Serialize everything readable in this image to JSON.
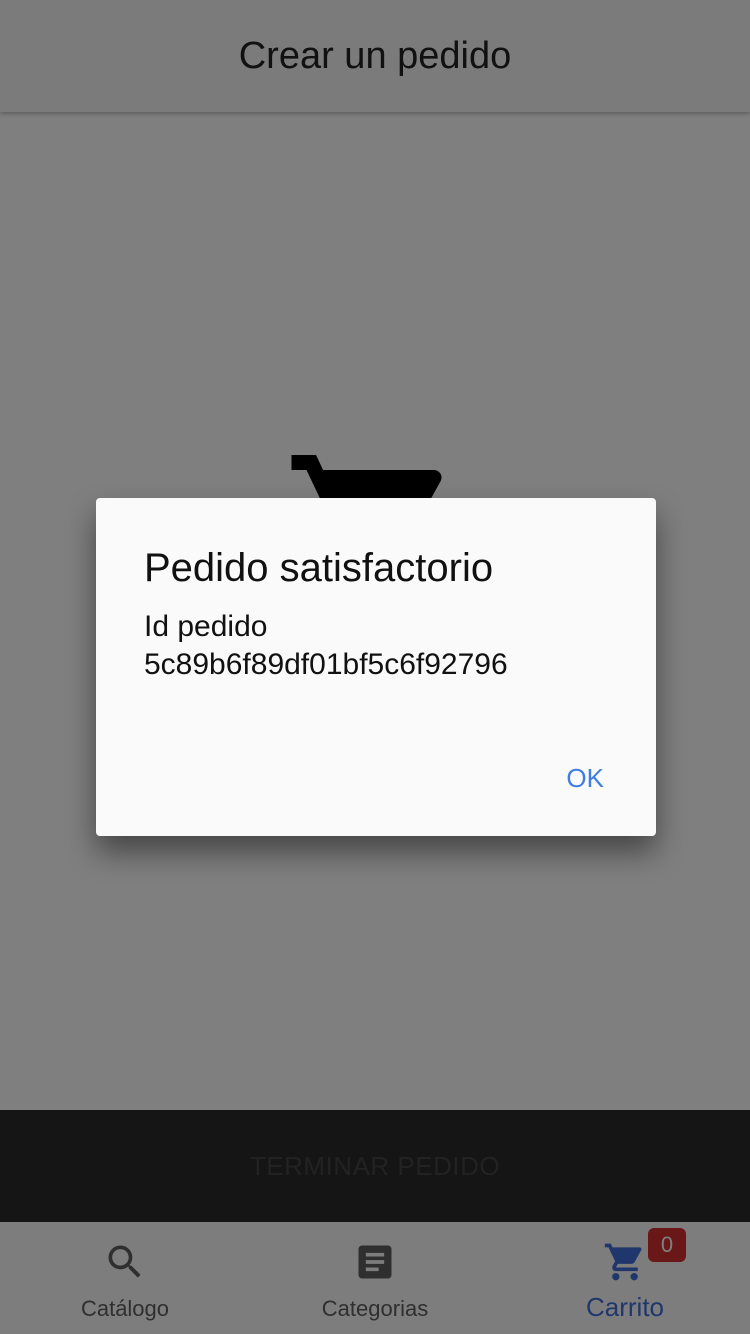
{
  "app_bar": {
    "title": "Crear un pedido"
  },
  "content": {
    "empty_cart_icon": "shopping-cart-icon"
  },
  "finish_bar": {
    "button_label": "TERMINAR PEDIDO"
  },
  "bottom_nav": {
    "items": [
      {
        "label": "Catálogo",
        "icon": "search-icon",
        "active": false
      },
      {
        "label": "Categorias",
        "icon": "article-icon",
        "active": false
      },
      {
        "label": "Carrito",
        "icon": "cart-icon",
        "active": true,
        "badge": "0"
      }
    ]
  },
  "dialog": {
    "title": "Pedido satisfactorio",
    "body_line1": "Id pedido",
    "body_line2": "5c89b6f89df01bf5c6f92796",
    "ok_label": "OK"
  },
  "colors": {
    "accent": "#3f6fd8",
    "badge": "#d32f2f",
    "scrim": "rgba(0,0,0,0.5)"
  }
}
